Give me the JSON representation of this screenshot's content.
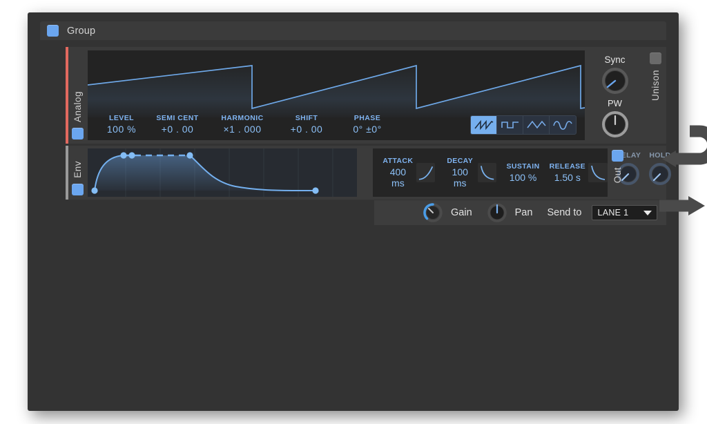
{
  "app": {
    "group_header": {
      "title": "Group",
      "toggle_state": "on",
      "toggle_color": "#6ba6ef"
    }
  },
  "modules": {
    "analog": {
      "name": "Analog",
      "accent_color": "#e2695f",
      "toggle_state": "on",
      "oscilloscope": {
        "waveform": "sawtooth",
        "cycles": 3,
        "stroke_color": "#6ea8e8",
        "background": "#232323"
      },
      "params": [
        {
          "label": "LEVEL",
          "value": "100 %"
        },
        {
          "label": "SEMI CENT",
          "value": "+0 . 00"
        },
        {
          "label": "HARMONIC",
          "value": "×1 . 000"
        },
        {
          "label": "SHIFT",
          "value": "+0 . 00"
        },
        {
          "label": "PHASE",
          "value": "0° ±0°"
        }
      ],
      "wave_selector": {
        "options": [
          "sawtooth-icon",
          "square-icon",
          "triangle-icon",
          "sine-icon"
        ],
        "selected_index": 0,
        "selected_color": "#76afee"
      },
      "knobs": [
        {
          "label": "Sync",
          "value_angle": -130,
          "indicator_color": "#6ba6ef"
        },
        {
          "label": "PW",
          "value_angle": 0,
          "indicator_color": "#b9b9b9"
        }
      ],
      "unison": {
        "label": "Unison",
        "toggle_state": "off",
        "toggle_color": "#6a6a6a"
      }
    },
    "env": {
      "name": "Env",
      "accent_color": "#9a9a9a",
      "toggle_state": "on",
      "adsr": [
        {
          "label": "ATTACK",
          "value": "400 ms",
          "curve": "attack-curve-icon"
        },
        {
          "label": "DECAY",
          "value": "100 ms",
          "curve": "decay-curve-icon"
        },
        {
          "label": "SUSTAIN",
          "value": "100 %",
          "curve": null
        },
        {
          "label": "RELEASE",
          "value": "1.50 s",
          "curve": "release-curve-icon"
        }
      ],
      "extra_knobs": [
        {
          "label": "DELAY",
          "value_angle": -135
        },
        {
          "label": "HOLD",
          "value_angle": -135
        }
      ]
    }
  },
  "out_bar": {
    "gain": {
      "label": "Gain",
      "arc_color": "#4a9de8",
      "value_angle": -120
    },
    "pan": {
      "label": "Pan",
      "indicator_color": "#6ba6ef",
      "value_angle": 0
    },
    "send_to_label": "Send to",
    "send_to_value": "LANE 1",
    "chevron": "chevron-down-icon"
  },
  "out_rail": {
    "label": "Out",
    "toggle_state": "on",
    "toggle_color": "#6ba6ef"
  },
  "routing": {
    "return_arrow": "arrow-loop-left-icon",
    "output_arrow": "arrow-right-icon"
  }
}
